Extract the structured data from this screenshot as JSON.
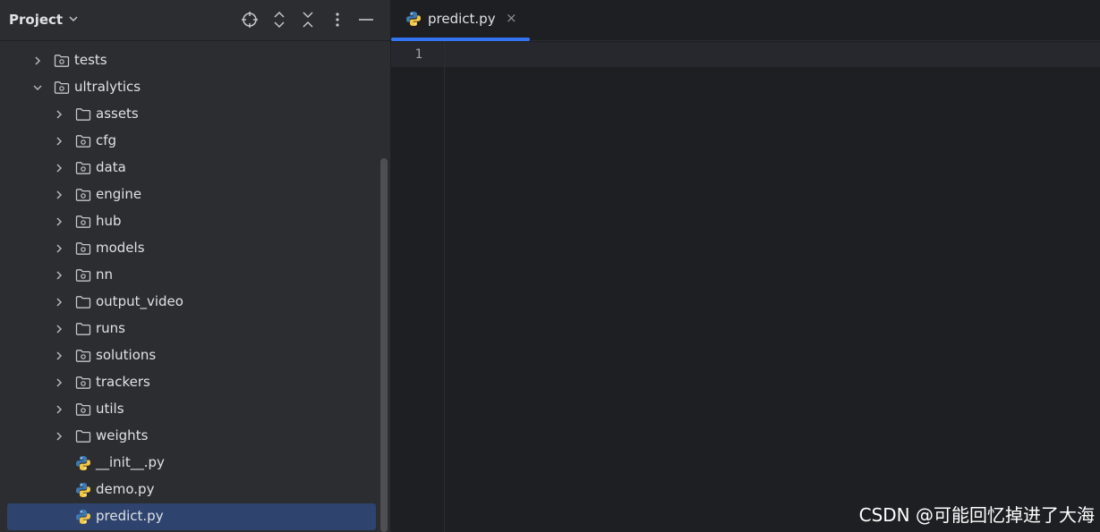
{
  "sidebar": {
    "title": "Project",
    "tree": [
      {
        "label": "tests",
        "type": "package",
        "depth": 1,
        "expanded": false,
        "chevron": true
      },
      {
        "label": "ultralytics",
        "type": "package",
        "depth": 1,
        "expanded": true,
        "chevron": true
      },
      {
        "label": "assets",
        "type": "folder",
        "depth": 2,
        "expanded": false,
        "chevron": true
      },
      {
        "label": "cfg",
        "type": "package",
        "depth": 2,
        "expanded": false,
        "chevron": true
      },
      {
        "label": "data",
        "type": "package",
        "depth": 2,
        "expanded": false,
        "chevron": true
      },
      {
        "label": "engine",
        "type": "package",
        "depth": 2,
        "expanded": false,
        "chevron": true
      },
      {
        "label": "hub",
        "type": "package",
        "depth": 2,
        "expanded": false,
        "chevron": true
      },
      {
        "label": "models",
        "type": "package",
        "depth": 2,
        "expanded": false,
        "chevron": true
      },
      {
        "label": "nn",
        "type": "package",
        "depth": 2,
        "expanded": false,
        "chevron": true
      },
      {
        "label": "output_video",
        "type": "folder",
        "depth": 2,
        "expanded": false,
        "chevron": true
      },
      {
        "label": "runs",
        "type": "folder",
        "depth": 2,
        "expanded": false,
        "chevron": true
      },
      {
        "label": "solutions",
        "type": "package",
        "depth": 2,
        "expanded": false,
        "chevron": true
      },
      {
        "label": "trackers",
        "type": "package",
        "depth": 2,
        "expanded": false,
        "chevron": true
      },
      {
        "label": "utils",
        "type": "package",
        "depth": 2,
        "expanded": false,
        "chevron": true
      },
      {
        "label": "weights",
        "type": "folder",
        "depth": 2,
        "expanded": false,
        "chevron": true
      },
      {
        "label": "__init__.py",
        "type": "python-file",
        "depth": 2,
        "expanded": false,
        "chevron": false
      },
      {
        "label": "demo.py",
        "type": "python-file",
        "depth": 2,
        "expanded": false,
        "chevron": false
      },
      {
        "label": "predict.py",
        "type": "python-file",
        "depth": 2,
        "expanded": false,
        "chevron": false,
        "selected": true
      }
    ]
  },
  "editor": {
    "tab": {
      "label": "predict.py",
      "close": "×"
    },
    "line_numbers": [
      "1"
    ]
  },
  "watermark": "CSDN @可能回忆掉进了大海",
  "colors": {
    "accent": "#3574f0",
    "selection": "#2e436e",
    "python_blue": "#3d7ab3",
    "python_yellow": "#f5c842"
  }
}
